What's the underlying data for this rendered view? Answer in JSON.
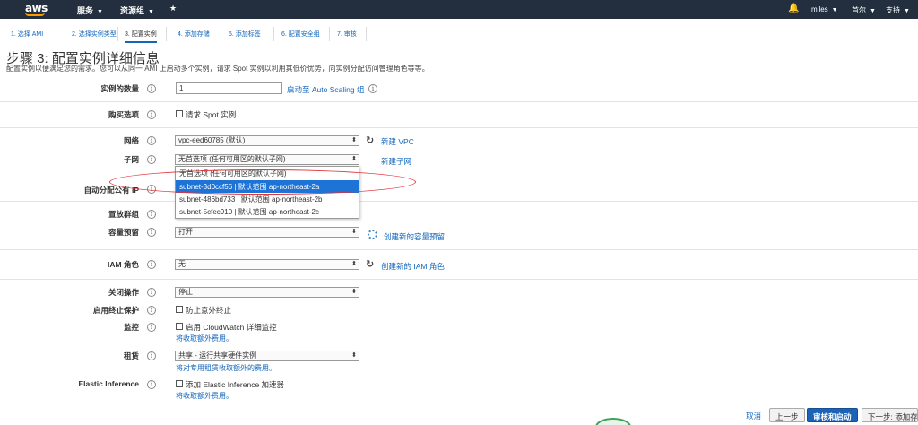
{
  "topnav": {
    "logo": "aws",
    "services": "服务",
    "resource_groups": "资源组",
    "user": "miles",
    "region": "首尔",
    "support": "支持"
  },
  "tabs": [
    {
      "label": "1. 选择 AMI"
    },
    {
      "label": "2. 选择实例类型"
    },
    {
      "label": "3. 配置实例"
    },
    {
      "label": "4. 添加存储"
    },
    {
      "label": "5. 添加标签"
    },
    {
      "label": "6. 配置安全组"
    },
    {
      "label": "7. 审核"
    }
  ],
  "page": {
    "title": "步骤 3: 配置实例详细信息",
    "description": "配置实例以便满足您的需求。您可以从同一 AMI 上启动多个实例，请求 Spot 实例以利用其低价优势，向实例分配访问管理角色等等。"
  },
  "form": {
    "instance_count": {
      "label": "实例的数量",
      "value": "1",
      "link": "启动至 Auto Scaling 组"
    },
    "purchase_option": {
      "label": "购买选项",
      "checkbox": "请求 Spot 实例"
    },
    "network": {
      "label": "网络",
      "value": "vpc-eed60785 (默认)",
      "link": "新建 VPC"
    },
    "subnet": {
      "label": "子网",
      "value": "无首选项 (任何可用区的默认子网)",
      "link": "新建子网"
    },
    "auto_ip": {
      "label": "自动分配公有 IP"
    },
    "placement_group": {
      "label": "置放群组"
    },
    "capacity_reservation": {
      "label": "容量预留",
      "value": "打开",
      "link": "创建新的容量预留"
    },
    "iam_role": {
      "label": "IAM 角色",
      "value": "无",
      "link": "创建新的 IAM 角色"
    },
    "shutdown_behavior": {
      "label": "关闭操作",
      "value": "停止"
    },
    "termination_protection": {
      "label": "启用终止保护",
      "checkbox": "防止意外终止"
    },
    "monitoring": {
      "label": "监控",
      "checkbox": "启用 CloudWatch 详细监控",
      "note": "将收取额外费用。"
    },
    "tenancy": {
      "label": "租赁",
      "value": "共享 - 运行共享硬件实例",
      "note": "将对专用租赁收取额外的费用。"
    },
    "elastic_inference": {
      "label": "Elastic Inference",
      "checkbox": "添加 Elastic Inference 加速器",
      "note": "将收取额外费用。"
    }
  },
  "subnet_dropdown": {
    "options": [
      "无首选项 (任何可用区的默认子网)",
      "subnet-3d0ccf56 | 默认范围 ap-northeast-2a",
      "subnet-486bd733 | 默认范围 ap-northeast-2b",
      "subnet-5cfec910 | 默认范围 ap-northeast-2c"
    ],
    "selected_index": 1
  },
  "footer": {
    "cancel": "取消",
    "previous": "上一步",
    "review_launch": "审核和启动",
    "next": "下一步: 添加存储"
  },
  "colors": {
    "nav_bg": "#232f3e",
    "accent": "#ff9900",
    "link": "#1166bb",
    "primary_button": "#1c63b7",
    "highlight_ellipse": "#e0343a"
  }
}
